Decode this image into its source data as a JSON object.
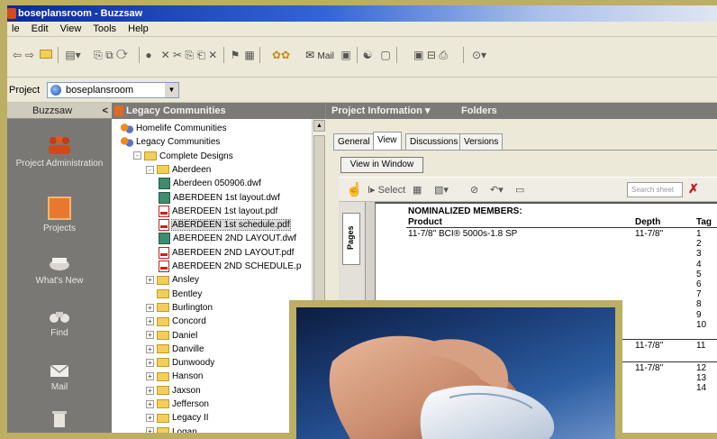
{
  "window": {
    "title": "boseplansroom - Buzzsaw"
  },
  "menu": [
    "le",
    "Edit",
    "View",
    "Tools",
    "Help"
  ],
  "toolbar": {
    "mail_label": "Mail"
  },
  "project": {
    "label": "Project",
    "selected": "boseplansroom"
  },
  "sidebar": {
    "title": "Buzzsaw",
    "close": "<",
    "items": [
      {
        "label": "Project Administration",
        "icon": "people-icon"
      },
      {
        "label": "Projects",
        "icon": "projects-icon"
      },
      {
        "label": "What's New",
        "icon": "whats-new-icon"
      },
      {
        "label": "Find",
        "icon": "binoculars-icon"
      },
      {
        "label": "Mail",
        "icon": "envelope-icon"
      },
      {
        "label": "",
        "icon": "recycle-bin-icon"
      }
    ]
  },
  "tree": {
    "title": "Legacy Communities",
    "items": [
      {
        "label": "Homelife Communities",
        "type": "community",
        "depth": 0,
        "toggle": ""
      },
      {
        "label": "Legacy Communities",
        "type": "community",
        "depth": 0,
        "toggle": ""
      },
      {
        "label": "Complete Designs",
        "type": "folder",
        "depth": 1,
        "toggle": "-"
      },
      {
        "label": "Aberdeen",
        "type": "folder",
        "depth": 2,
        "toggle": "-"
      },
      {
        "label": "Aberdeen 050906.dwf",
        "type": "dwf",
        "depth": 3,
        "toggle": ""
      },
      {
        "label": "ABERDEEN 1st layout.dwf",
        "type": "dwf",
        "depth": 3,
        "toggle": ""
      },
      {
        "label": "ABERDEEN 1st layout.pdf",
        "type": "pdf",
        "depth": 3,
        "toggle": ""
      },
      {
        "label": "ABERDEEN 1st schedule.pdf",
        "type": "pdf",
        "depth": 3,
        "toggle": "",
        "selected": true
      },
      {
        "label": "ABERDEEN 2ND LAYOUT.dwf",
        "type": "dwf",
        "depth": 3,
        "toggle": ""
      },
      {
        "label": "ABERDEEN 2ND LAYOUT.pdf",
        "type": "pdf",
        "depth": 3,
        "toggle": ""
      },
      {
        "label": "ABERDEEN 2ND SCHEDULE.p",
        "type": "pdf",
        "depth": 3,
        "toggle": ""
      },
      {
        "label": "Ansley",
        "type": "folder",
        "depth": 2,
        "toggle": "+"
      },
      {
        "label": "Bentley",
        "type": "folder",
        "depth": 2,
        "toggle": ""
      },
      {
        "label": "Burlington",
        "type": "folder",
        "depth": 2,
        "toggle": "+"
      },
      {
        "label": "Concord",
        "type": "folder",
        "depth": 2,
        "toggle": "+"
      },
      {
        "label": "Daniel",
        "type": "folder",
        "depth": 2,
        "toggle": "+"
      },
      {
        "label": "Danville",
        "type": "folder",
        "depth": 2,
        "toggle": "+"
      },
      {
        "label": "Dunwoody",
        "type": "folder",
        "depth": 2,
        "toggle": "+"
      },
      {
        "label": "Hanson",
        "type": "folder",
        "depth": 2,
        "toggle": "+"
      },
      {
        "label": "Jaxson",
        "type": "folder",
        "depth": 2,
        "toggle": "+"
      },
      {
        "label": "Jefferson",
        "type": "folder",
        "depth": 2,
        "toggle": "+"
      },
      {
        "label": "Legacy II",
        "type": "folder",
        "depth": 2,
        "toggle": "+"
      },
      {
        "label": "Logan",
        "type": "folder",
        "depth": 2,
        "toggle": "+"
      }
    ]
  },
  "right": {
    "header_left": "Project Information",
    "header_dropdown": "▾",
    "header_right": "Folders",
    "tabs": [
      "General",
      "View",
      "Discussions",
      "Versions"
    ],
    "active_tab": "View",
    "view_in_window": "View in Window",
    "select_label": "Select",
    "search_placeholder": "Search sheet",
    "pages_tab": "Pages"
  },
  "document": {
    "heading": "NOMINALIZED MEMBERS:",
    "col_product": "Product",
    "col_depth": "Depth",
    "col_tag": "Tag",
    "row1_product": "11-7/8\" BCI® 5000s-1.8 SP",
    "row1_depth": "11-7/8\"",
    "tags_a": [
      "1",
      "2",
      "3",
      "4",
      "5",
      "6",
      "7",
      "8",
      "9",
      "10"
    ],
    "row2_depth": "11-7/8\"",
    "row2_tag": "11",
    "row3_depth": "11-7/8\"",
    "tags_b": [
      "12",
      "13",
      "14"
    ]
  }
}
